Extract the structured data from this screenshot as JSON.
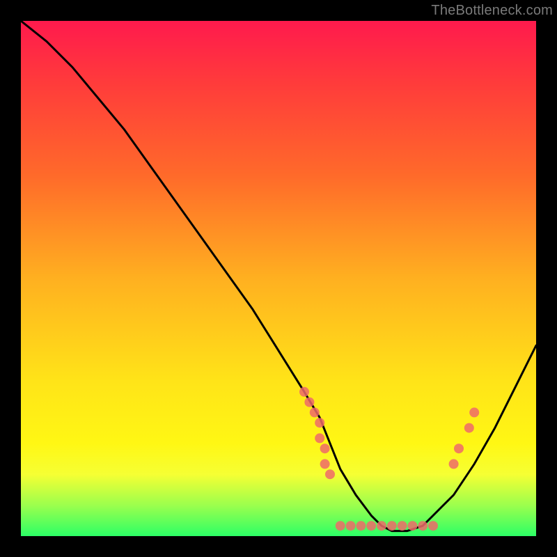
{
  "watermark": "TheBottleneck.com",
  "chart_data": {
    "type": "line",
    "title": "",
    "xlabel": "",
    "ylabel": "",
    "xlim": [
      0,
      100
    ],
    "ylim": [
      0,
      100
    ],
    "series": [
      {
        "name": "bottleneck-curve",
        "x": [
          0,
          5,
          10,
          15,
          20,
          25,
          30,
          35,
          40,
          45,
          50,
          55,
          58,
          60,
          62,
          65,
          68,
          70,
          72,
          75,
          78,
          80,
          84,
          88,
          92,
          96,
          100
        ],
        "values": [
          100,
          96,
          91,
          85,
          79,
          72,
          65,
          58,
          51,
          44,
          36,
          28,
          23,
          18,
          13,
          8,
          4,
          2,
          1,
          1,
          2,
          4,
          8,
          14,
          21,
          29,
          37
        ]
      }
    ],
    "highlight_points": [
      {
        "x": 55,
        "y": 28
      },
      {
        "x": 56,
        "y": 26
      },
      {
        "x": 57,
        "y": 24
      },
      {
        "x": 58,
        "y": 22
      },
      {
        "x": 58,
        "y": 19
      },
      {
        "x": 59,
        "y": 17
      },
      {
        "x": 59,
        "y": 14
      },
      {
        "x": 60,
        "y": 12
      },
      {
        "x": 62,
        "y": 2
      },
      {
        "x": 64,
        "y": 2
      },
      {
        "x": 66,
        "y": 2
      },
      {
        "x": 68,
        "y": 2
      },
      {
        "x": 70,
        "y": 2
      },
      {
        "x": 72,
        "y": 2
      },
      {
        "x": 74,
        "y": 2
      },
      {
        "x": 76,
        "y": 2
      },
      {
        "x": 78,
        "y": 2
      },
      {
        "x": 80,
        "y": 2
      },
      {
        "x": 84,
        "y": 14
      },
      {
        "x": 85,
        "y": 17
      },
      {
        "x": 87,
        "y": 21
      },
      {
        "x": 88,
        "y": 24
      }
    ],
    "highlight_color": "#ef6a6a",
    "curve_color": "#000000",
    "gradient_stops": [
      {
        "pos": 0,
        "color": "#ff1a4d"
      },
      {
        "pos": 12,
        "color": "#ff3b3b"
      },
      {
        "pos": 30,
        "color": "#ff6a2a"
      },
      {
        "pos": 50,
        "color": "#ffb020"
      },
      {
        "pos": 70,
        "color": "#ffe418"
      },
      {
        "pos": 82,
        "color": "#fff714"
      },
      {
        "pos": 88,
        "color": "#f6ff33"
      },
      {
        "pos": 94,
        "color": "#9cff4d"
      },
      {
        "pos": 100,
        "color": "#2cff66"
      }
    ]
  }
}
